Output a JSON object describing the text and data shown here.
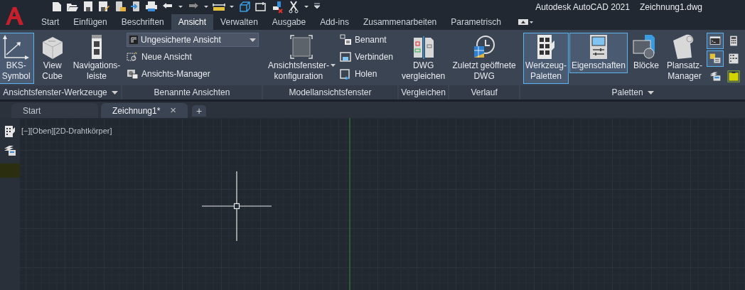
{
  "title": {
    "app": "Autodesk AutoCAD 2021",
    "file": "Zeichnung1.dwg"
  },
  "ribbon_tabs": [
    {
      "label": "Start",
      "selected": false
    },
    {
      "label": "Einfügen",
      "selected": false
    },
    {
      "label": "Beschriften",
      "selected": false
    },
    {
      "label": "Ansicht",
      "selected": true
    },
    {
      "label": "Verwalten",
      "selected": false
    },
    {
      "label": "Ausgabe",
      "selected": false
    },
    {
      "label": "Add-ins",
      "selected": false
    },
    {
      "label": "Zusammenarbeiten",
      "selected": false
    },
    {
      "label": "Parametrisch",
      "selected": false
    }
  ],
  "panels": [
    {
      "title": "Ansichtsfenster-Werkzeuge",
      "menu": true,
      "items": [
        {
          "kind": "large",
          "lines": [
            "BKS-",
            "Symbol"
          ],
          "selected": true
        },
        {
          "kind": "large",
          "lines": [
            "View",
            "Cube"
          ],
          "selected": false
        },
        {
          "kind": "large",
          "lines": [
            "Navigations-",
            "leiste"
          ],
          "selected": false
        }
      ]
    },
    {
      "title": "Benannte Ansichten",
      "menu": false,
      "items": [
        {
          "kind": "dropdown",
          "value": "Ungesicherte Ansicht"
        },
        {
          "kind": "small",
          "label": "Neue Ansicht"
        },
        {
          "kind": "small",
          "label": "Ansichts-Manager"
        }
      ]
    },
    {
      "title": "Modellansichtsfenster",
      "menu": false,
      "items": [
        {
          "kind": "large",
          "lines": [
            "Ansichtsfenster-",
            "konfiguration"
          ],
          "selected": false,
          "split": true
        },
        {
          "kind": "small",
          "label": "Benannt"
        },
        {
          "kind": "small",
          "label": "Verbinden"
        },
        {
          "kind": "small",
          "label": "Holen"
        }
      ]
    },
    {
      "title": "Vergleichen",
      "menu": false,
      "items": [
        {
          "kind": "large",
          "lines": [
            "DWG",
            "vergleichen"
          ],
          "selected": false
        }
      ]
    },
    {
      "title": "Verlauf",
      "menu": false,
      "items": [
        {
          "kind": "large",
          "lines": [
            "Zuletzt geöffnete",
            "DWG"
          ],
          "selected": false
        }
      ]
    },
    {
      "title": "Paletten",
      "menu": true,
      "items": [
        {
          "kind": "large",
          "lines": [
            "Werkzeug-",
            "Paletten"
          ],
          "selected": true
        },
        {
          "kind": "large",
          "lines": [
            "Eigenschaften"
          ],
          "selected": true
        },
        {
          "kind": "large",
          "lines": [
            "Blöcke"
          ],
          "selected": false
        },
        {
          "kind": "large",
          "lines": [
            "Plansatz-",
            "Manager"
          ],
          "selected": false
        },
        {
          "kind": "icon",
          "selected": true
        },
        {
          "kind": "icon",
          "selected": true
        },
        {
          "kind": "icon",
          "selected": false
        },
        {
          "kind": "icon",
          "selected": false
        },
        {
          "kind": "icon",
          "selected": false
        },
        {
          "kind": "icon",
          "selected": false
        }
      ]
    }
  ],
  "doc_tabs": [
    {
      "label": "Start",
      "selected": false
    },
    {
      "label": "Zeichnung1*",
      "selected": true,
      "close": "×"
    }
  ],
  "new_tab": "+",
  "viewport_label": "[−][Oben][2D-Drahtkörper]"
}
